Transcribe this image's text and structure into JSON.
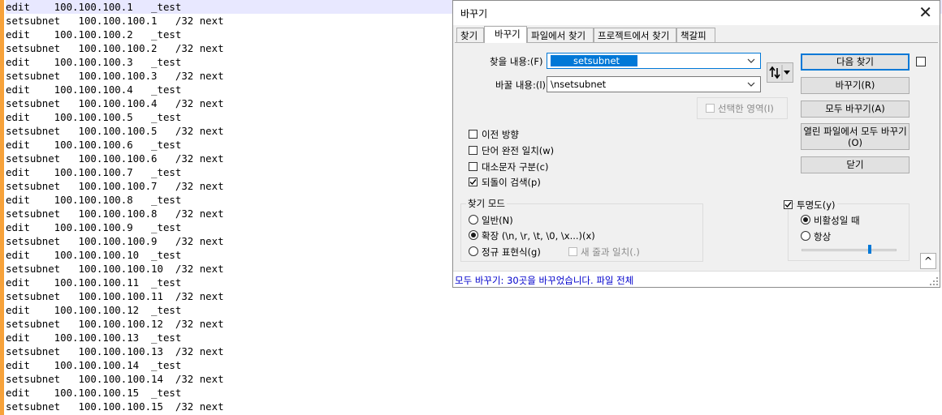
{
  "editor": {
    "lines": [
      "edit    100.100.100.1   _test",
      "setsubnet   100.100.100.1   /32 next",
      "edit    100.100.100.2   _test",
      "setsubnet   100.100.100.2   /32 next",
      "edit    100.100.100.3   _test",
      "setsubnet   100.100.100.3   /32 next",
      "edit    100.100.100.4   _test",
      "setsubnet   100.100.100.4   /32 next",
      "edit    100.100.100.5   _test",
      "setsubnet   100.100.100.5   /32 next",
      "edit    100.100.100.6   _test",
      "setsubnet   100.100.100.6   /32 next",
      "edit    100.100.100.7   _test",
      "setsubnet   100.100.100.7   /32 next",
      "edit    100.100.100.8   _test",
      "setsubnet   100.100.100.8   /32 next",
      "edit    100.100.100.9   _test",
      "setsubnet   100.100.100.9   /32 next",
      "edit    100.100.100.10  _test",
      "setsubnet   100.100.100.10  /32 next",
      "edit    100.100.100.11  _test",
      "setsubnet   100.100.100.11  /32 next",
      "edit    100.100.100.12  _test",
      "setsubnet   100.100.100.12  /32 next",
      "edit    100.100.100.13  _test",
      "setsubnet   100.100.100.13  /32 next",
      "edit    100.100.100.14  _test",
      "setsubnet   100.100.100.14  /32 next",
      "edit    100.100.100.15  _test",
      "setsubnet   100.100.100.15  /32 next"
    ],
    "gutter_color": "#f7a23a",
    "current_line_color": "#e8e8ff"
  },
  "dialog": {
    "title": "바꾸기",
    "tabs": [
      {
        "label": "찾기"
      },
      {
        "label": "바꾸기"
      },
      {
        "label": "파일에서 찾기"
      },
      {
        "label": "프로젝트에서 찾기"
      },
      {
        "label": "책갈피"
      }
    ],
    "active_tab": "바꾸기",
    "find_label": "찾을 내용:(F)",
    "find_value": "setsubnet",
    "replace_label": "바꿀 내용:(l)",
    "replace_value": "\\nsetsubnet",
    "in_selection_label": "선택한 영역(I)",
    "buttons": {
      "find_next": "다음 찾기",
      "replace": "바꾸기(R)",
      "replace_all": "모두 바꾸기(A)",
      "replace_all_open_line1": "열린 파일에서 모두 바꾸기",
      "replace_all_open_line2": "(O)",
      "close": "닫기"
    },
    "options": [
      {
        "label": "이전 방향",
        "checked": false
      },
      {
        "label": "단어 완전 일치(w)",
        "checked": false
      },
      {
        "label": "대소문자 구분(c)",
        "checked": false
      },
      {
        "label": "되돌이 검색(p)",
        "checked": true
      }
    ],
    "search_mode": {
      "title": "찾기 모드",
      "normal": "일반(N)",
      "extended": "확장 (\\n, \\r, \\t, \\0, \\x...)(x)",
      "regex": "정규 표현식(g)",
      "dot_newline": "새 줄과 일치(.)",
      "selected": "extended"
    },
    "transparency": {
      "label": "투명도(y)",
      "checked": true,
      "on_losing_focus": "비활성일 때",
      "always": "항상",
      "selected": "on_losing_focus",
      "level_fraction": 0.72
    },
    "collapse_label": "^",
    "status": "모두 바꾸기: 30곳을 바꾸었습니다. 파일 전체",
    "accent_color": "#0078d7",
    "status_color": "#0000cc"
  }
}
